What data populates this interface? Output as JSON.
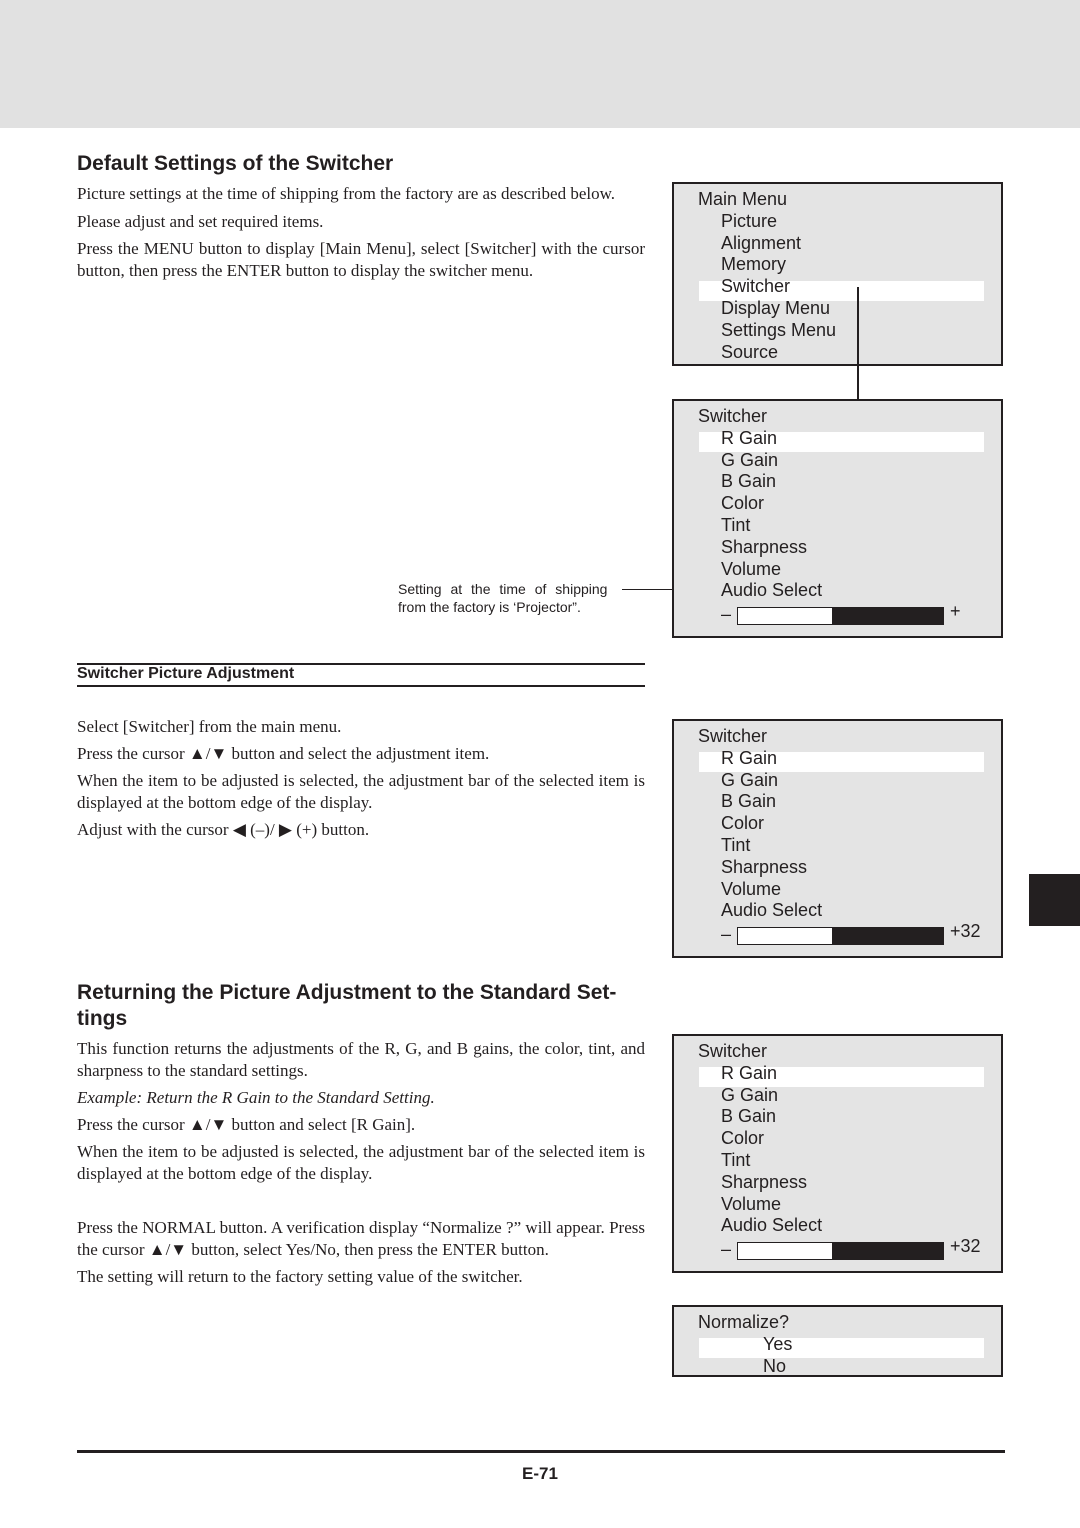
{
  "section1": {
    "title": "Default Settings of the Switcher",
    "p1": "Picture settings at the time of shipping from the factory are as described below.",
    "p2": "Please adjust and set required items.",
    "p3": "Press the MENU button to display [Main Menu], select [Switcher] with the cursor button, then press the ENTER button to display the switcher menu.",
    "note_line1": "Setting at the time of shipping",
    "note_line2": "from the factory is ‘Projector”."
  },
  "section2": {
    "title": "Switcher Picture Adjustment",
    "p1": "Select [Switcher] from the main menu.",
    "p2": "Press the cursor ▲/▼ button and select the adjustment item.",
    "p3": "When the item to be adjusted is selected, the adjustment bar of the selected item is displayed at the bottom edge of the display.",
    "p4": "Adjust with the cursor ◀ (–)/ ▶ (+) button."
  },
  "section3": {
    "title": "Returning the Picture Adjustment to the Standard Set- tings",
    "p1": "This function returns the adjustments of the R, G, and B gains, the color, tint, and sharpness to the standard settings.",
    "example": "Example: Return the R Gain to the Standard Setting.",
    "p2": "Press the cursor ▲/▼ button and select [R Gain].",
    "p3": "When the item to be adjusted is selected, the adjustment bar of the selected item is displayed at the bottom edge of the display.",
    "p4": "Press the NORMAL button. A verification display “Normalize ?” will appear. Press the cursor ▲/▼ button, select Yes/No, then press the ENTER button.",
    "p5": "The setting will return to the factory setting value of the switcher."
  },
  "menus": [
    {
      "name": "main-menu",
      "title": "Main Menu",
      "items": [
        "Picture",
        "Alignment",
        "Memory",
        "Switcher",
        "Display Menu",
        "Settings Menu",
        "Source"
      ],
      "selected": 3
    },
    {
      "name": "switcher-menu-default",
      "title": "Switcher",
      "items": [
        "R Gain",
        "G Gain",
        "B Gain",
        "Color",
        "Tint",
        "Sharpness",
        "Volume",
        "Audio Select"
      ],
      "selected": 0,
      "bar": {
        "minus": "–",
        "plus": "+",
        "level": 0.46
      }
    },
    {
      "name": "switcher-menu-adjust",
      "title": "Switcher",
      "items": [
        "R Gain",
        "G Gain",
        "B Gain",
        "Color",
        "Tint",
        "Sharpness",
        "Volume",
        "Audio Select"
      ],
      "selected": 0,
      "bar": {
        "minus": "–",
        "plus": "+32",
        "level": 0.46
      }
    },
    {
      "name": "switcher-menu-normalize",
      "title": "Switcher",
      "items": [
        "R Gain",
        "G Gain",
        "B Gain",
        "Color",
        "Tint",
        "Sharpness",
        "Volume",
        "Audio Select"
      ],
      "selected": 0,
      "bar": {
        "minus": "–",
        "plus": "+32",
        "level": 0.46
      }
    },
    {
      "name": "normalize-dialog",
      "title": "Normalize?",
      "items": [
        "Yes",
        "No"
      ],
      "selected": 0,
      "indent": "deep"
    }
  ],
  "footer": {
    "page_number": "E-71"
  },
  "colors": {
    "menu_bg": "#e4e4e4",
    "highlight": "#ffffff",
    "ink": "#231f20",
    "band": "#e1e1e1"
  }
}
